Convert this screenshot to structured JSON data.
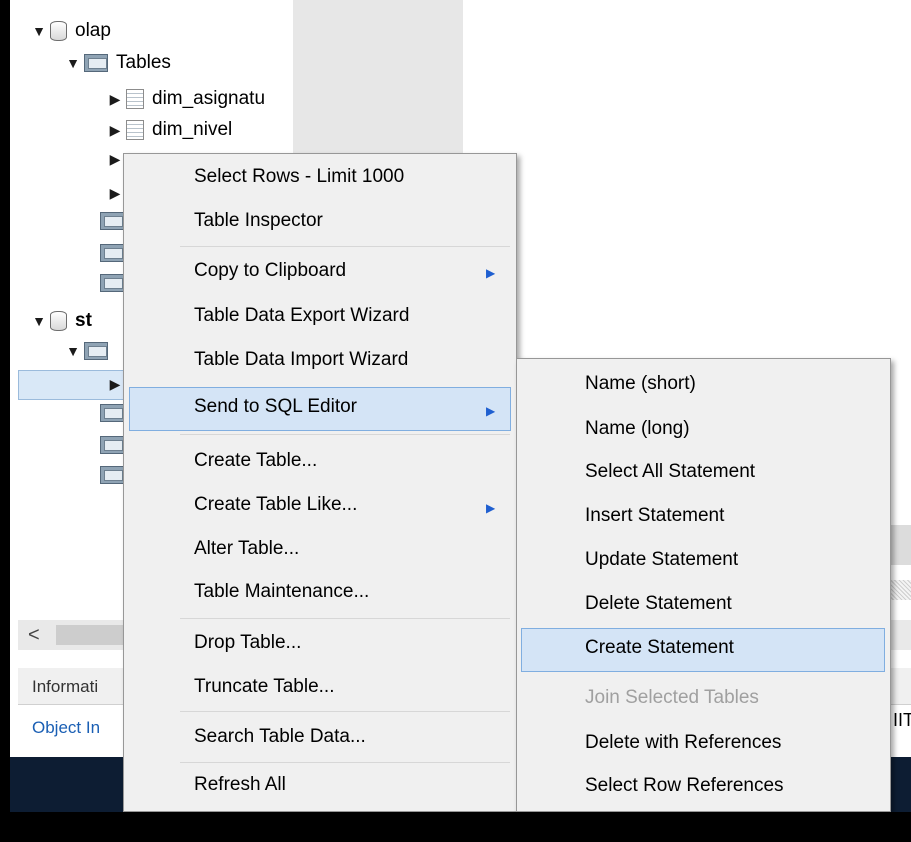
{
  "tree": {
    "olap_label": "olap",
    "tables_label": "Tables",
    "table1": "dim_asignatu",
    "table2": "dim_nivel",
    "second_schema_partial": "st"
  },
  "bottom": {
    "info_tab": "Informati",
    "object_info": "Object In",
    "right_partial": "IIT"
  },
  "context_menu": {
    "items": [
      "Select Rows - Limit 1000",
      "Table Inspector",
      "Copy to Clipboard",
      "Table Data Export Wizard",
      "Table Data Import Wizard",
      "Send to SQL Editor",
      "Create Table...",
      "Create Table Like...",
      "Alter Table...",
      "Table Maintenance...",
      "Drop Table...",
      "Truncate Table...",
      "Search Table Data...",
      "Refresh All"
    ]
  },
  "submenu": {
    "items": [
      "Name (short)",
      "Name (long)",
      "Select All Statement",
      "Insert Statement",
      "Update Statement",
      "Delete Statement",
      "Create Statement",
      "Join Selected Tables",
      "Delete with References",
      "Select Row References"
    ],
    "disabled_item": "Join Selected Tables"
  },
  "colors": {
    "highlight": "#d4e4f6",
    "highlight_border": "#80aee0",
    "link": "#1a5fb4",
    "dark_band": "#0d1d33"
  }
}
